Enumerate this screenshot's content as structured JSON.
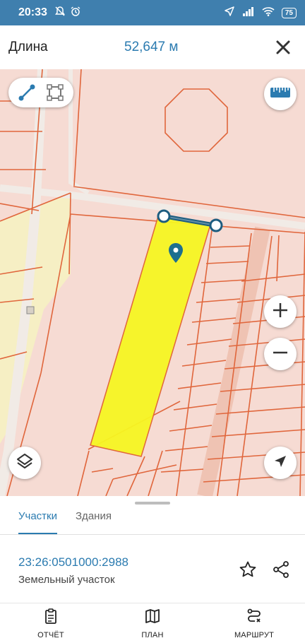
{
  "status_bar": {
    "time": "20:33",
    "battery": "75",
    "icons": [
      "mute-bell-icon",
      "alarm-icon",
      "location-arrow-icon",
      "signal-icon",
      "wifi-icon",
      "battery-icon"
    ]
  },
  "header": {
    "label": "Длина",
    "value": "52,647 м"
  },
  "map": {
    "highlight_color": "#f5f522",
    "parcel_line_color": "#e0663c",
    "measure_line_color": "#1d5d80"
  },
  "tabs": [
    {
      "label": "Участки",
      "active": true
    },
    {
      "label": "Здания",
      "active": false
    }
  ],
  "parcel": {
    "id": "23:26:0501000:2988",
    "type": "Земельный участок"
  },
  "bottom_nav": [
    {
      "label": "ОТЧЁТ",
      "icon": "clipboard-icon"
    },
    {
      "label": "ПЛАН",
      "icon": "map-icon"
    },
    {
      "label": "МАРШРУТ",
      "icon": "route-icon"
    }
  ],
  "colors": {
    "accent": "#2b7bb0",
    "status_bar": "#3f7fae"
  }
}
